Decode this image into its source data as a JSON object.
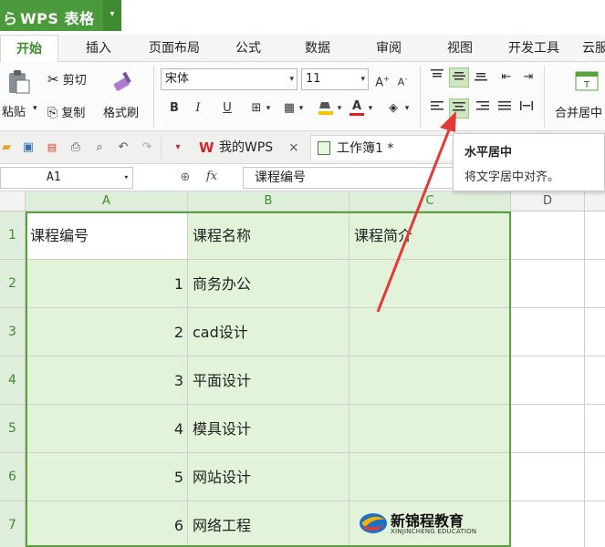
{
  "app": {
    "logo_glyph": "ら",
    "name": "WPS 表格",
    "menu_arrow": "▾"
  },
  "tabs": [
    "开始",
    "插入",
    "页面布局",
    "公式",
    "数据",
    "审阅",
    "视图",
    "开发工具",
    "云服"
  ],
  "ribbon": {
    "paste": "粘贴",
    "cut": "剪切",
    "copy": "复制",
    "format_painter": "格式刷",
    "font": "宋体",
    "font_size": "11",
    "merge_center": "合并居中"
  },
  "quick_access": {
    "doc_tabs": [
      {
        "label": "我的WPS",
        "close": "×"
      },
      {
        "label": "工作簿1 *"
      }
    ]
  },
  "formula_bar": {
    "name_box": "A1",
    "fx": "fx",
    "value": "课程编号"
  },
  "tooltip": {
    "title": "水平居中",
    "desc": "将文字居中对齐。"
  },
  "columns": [
    "A",
    "B",
    "C",
    "D"
  ],
  "rows": [
    {
      "num": "1",
      "a": "课程编号",
      "b": "课程名称",
      "c": "课程简介"
    },
    {
      "num": "2",
      "a": "1",
      "b": "商务办公",
      "c": ""
    },
    {
      "num": "3",
      "a": "2",
      "b": "cad设计",
      "c": ""
    },
    {
      "num": "4",
      "a": "3",
      "b": "平面设计",
      "c": ""
    },
    {
      "num": "5",
      "a": "4",
      "b": "模具设计",
      "c": ""
    },
    {
      "num": "6",
      "a": "5",
      "b": "网站设计",
      "c": ""
    },
    {
      "num": "7",
      "a": "6",
      "b": "网络工程",
      "c": ""
    }
  ],
  "watermark": {
    "cn": "新锦程教育",
    "en": "XINJINCHENG EDUCATION"
  },
  "colors": {
    "brand": "#4b9b3c",
    "selection": "#5aa23e",
    "highlight": "#e2f3da",
    "arrow": "#e53935"
  }
}
